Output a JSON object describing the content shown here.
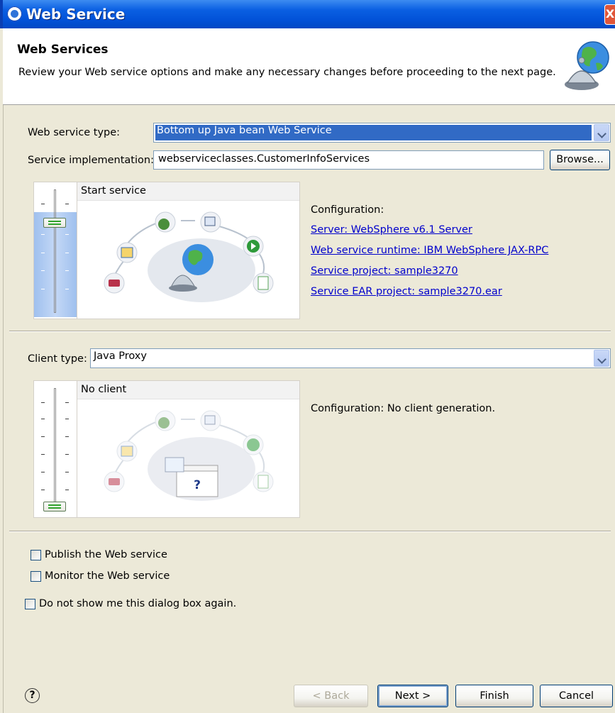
{
  "window": {
    "title": "Web Service",
    "close_glyph": "X"
  },
  "header": {
    "title": "Web Services",
    "description": "Review your Web service options and make any necessary changes before proceeding to the next page.",
    "image_icon": "globe-bell-icon"
  },
  "service": {
    "type_label": "Web service type:",
    "type_value": "Bottom up Java bean Web Service",
    "impl_label": "Service implementation:",
    "impl_value": "webserviceclasses.CustomerInfoServices",
    "browse_label": "Browse...",
    "stage_caption": "Start service",
    "config_label": "Configuration:",
    "config_links": [
      "Server: WebSphere v6.1 Server",
      "Web service runtime: IBM WebSphere JAX-RPC",
      "Service project: sample3270",
      "Service EAR project: sample3270.ear"
    ]
  },
  "client": {
    "type_label": "Client type:",
    "type_value": "Java Proxy",
    "stage_caption": "No client",
    "config_text": "Configuration: No client generation."
  },
  "options": {
    "publish": {
      "label": "Publish the Web service",
      "checked": false
    },
    "monitor": {
      "label": "Monitor the Web service",
      "checked": false
    },
    "dont_show": {
      "label": "Do not show me this dialog box again.",
      "checked": false
    }
  },
  "footer": {
    "help_glyph": "?",
    "back_label": "< Back",
    "next_label": "Next >",
    "finish_label": "Finish",
    "cancel_label": "Cancel"
  },
  "colors": {
    "titlebar": "#0A5FE2",
    "selection": "#316AC5",
    "link": "#0000CC",
    "dialog_bg": "#ECE9D8"
  }
}
